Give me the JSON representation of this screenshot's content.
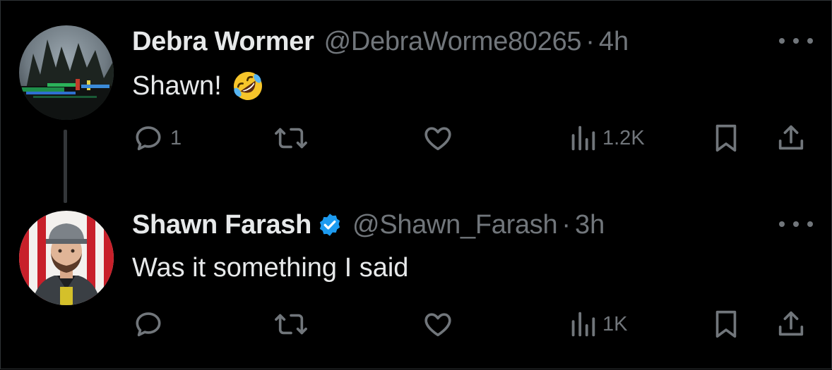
{
  "colors": {
    "background": "#000000",
    "primary_text": "#e7e9ea",
    "secondary_text": "#71767b",
    "verified_badge": "#1d9bf0",
    "thread_line": "#333639"
  },
  "tweets": [
    {
      "display_name": "Debra Wormer",
      "verified": false,
      "handle": "@DebraWorme80265",
      "separator": "·",
      "time": "4h",
      "text": "Shawn!",
      "emoji": "rolling-on-floor-laughing",
      "actions": {
        "reply_count": "1",
        "retweet_count": "",
        "like_count": "",
        "views_count": "1.2K"
      }
    },
    {
      "display_name": "Shawn Farash",
      "verified": true,
      "handle": "@Shawn_Farash",
      "separator": "·",
      "time": "3h",
      "text": "Was it something I said",
      "actions": {
        "reply_count": "",
        "retweet_count": "",
        "like_count": "",
        "views_count": "1K"
      }
    }
  ]
}
